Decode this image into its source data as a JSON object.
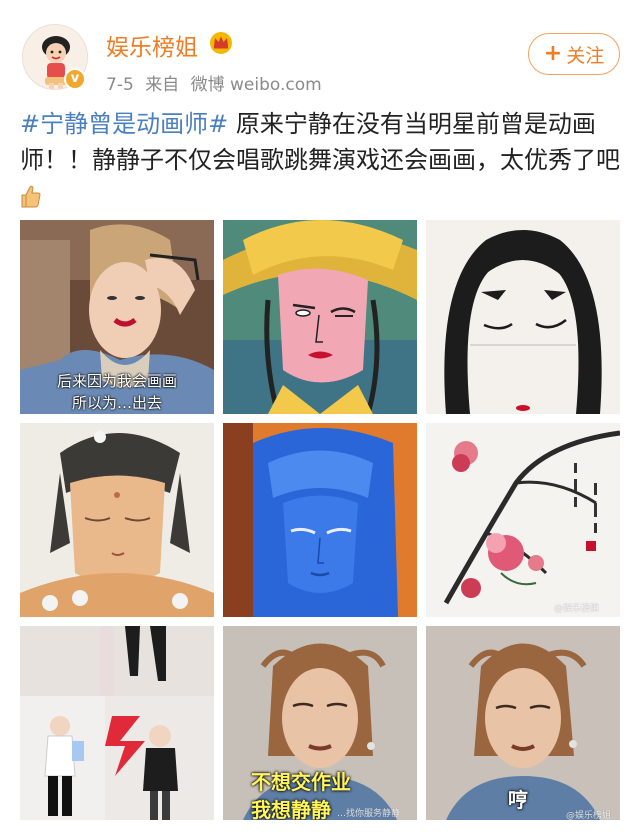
{
  "header": {
    "username": "娱乐榜姐",
    "date": "7-5",
    "source_prefix": "来自",
    "source": "微博 weibo.com",
    "follow_label": "关注",
    "verified_mark": "v"
  },
  "post": {
    "hashtag": "#宁静曾是动画师#",
    "body": " 原来宁静在没有当明星前曾是动画师！！静静子不仅会唱歌跳舞演戏还会画画，太优秀了吧"
  },
  "images": {
    "img1_caption_line1": "后来因为我会画画",
    "img1_caption_line2": "所以为…出去",
    "img9_caption": "哼",
    "img8_caption_line1": "不想交作业",
    "img8_caption_line2": "我想静静",
    "img8_watermark": "…找你服务静静",
    "img9_watermark": "@娱乐榜姐",
    "img6_watermark": "@娱乐榜姐"
  },
  "colors": {
    "accent": "#f07c24",
    "link": "#4a7fc1",
    "caption_yellow": "#fff45a"
  },
  "icons": [
    "crown-icon",
    "verified-icon",
    "plus-icon",
    "thumbs-up-icon"
  ]
}
